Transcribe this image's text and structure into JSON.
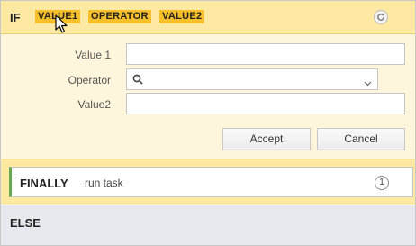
{
  "if_block": {
    "label": "IF",
    "chips": [
      "VALUE1",
      "OPERATOR",
      "VALUE2"
    ],
    "refresh_icon": "refresh-icon"
  },
  "form": {
    "value1_label": "Value 1",
    "value1_value": "",
    "operator_label": "Operator",
    "operator_value": "",
    "value2_label": "Value2",
    "value2_value": ""
  },
  "buttons": {
    "accept": "Accept",
    "cancel": "Cancel"
  },
  "finally_block": {
    "label": "FINALLY",
    "text": "run task",
    "count": "1"
  },
  "else_block": {
    "label": "ELSE"
  },
  "colors": {
    "header_bg": "#fde9a2",
    "chip_bg": "#f7c02a",
    "form_bg": "#fef6dc",
    "finally_accent": "#6aa84f",
    "else_bg": "#e7e9ee"
  }
}
